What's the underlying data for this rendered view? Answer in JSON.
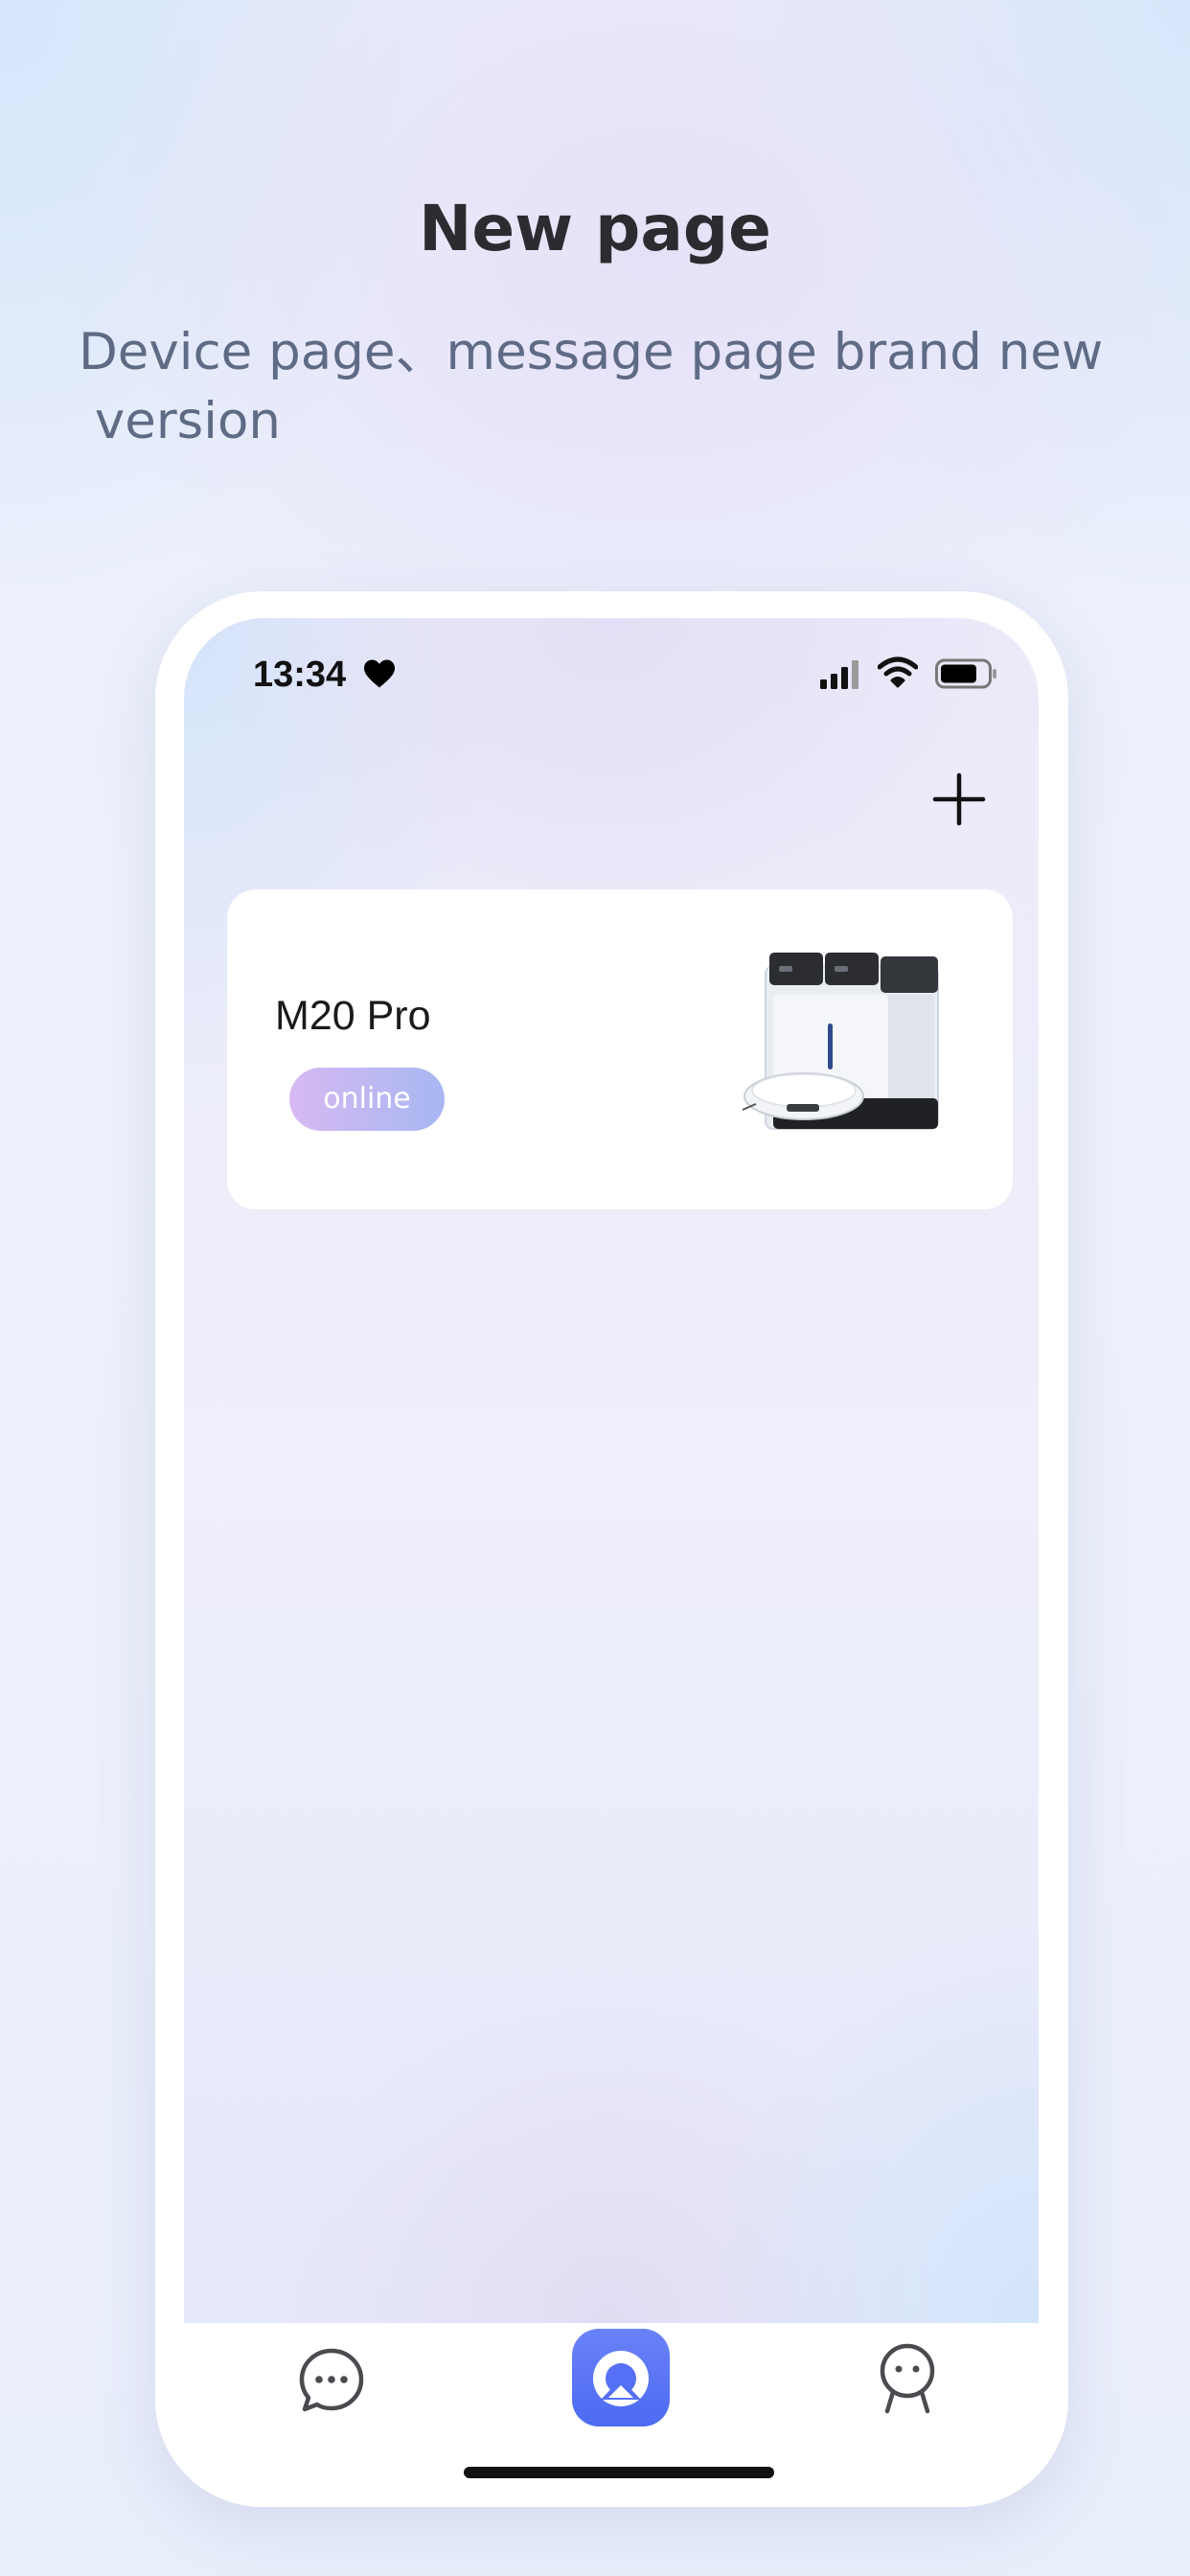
{
  "promo": {
    "title": "New page",
    "subtitle_line1": "Device page、message page brand new",
    "subtitle_line2": " version"
  },
  "status_bar": {
    "time": "13:34",
    "icons": [
      "heart-icon",
      "cellular-signal-icon",
      "wifi-icon",
      "battery-icon"
    ]
  },
  "header": {
    "add_icon": "plus-icon"
  },
  "devices": [
    {
      "name": "M20 Pro",
      "status": "online",
      "image": "robot-vacuum-with-station"
    }
  ],
  "tab_bar": {
    "items": [
      "messages-icon",
      "home-icon",
      "profile-icon"
    ],
    "active": "home-icon"
  },
  "colors": {
    "accent": "#5570f4",
    "badge_start": "#d7b9f2",
    "badge_end": "#a7b7f2",
    "title_text": "#2c2c30",
    "subtitle_text": "#5f6b85"
  }
}
